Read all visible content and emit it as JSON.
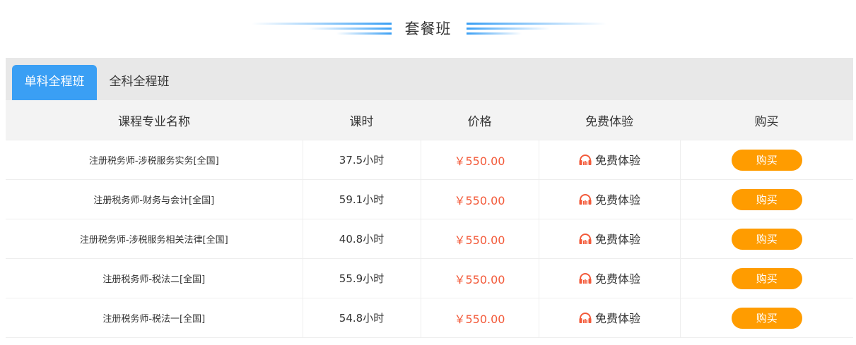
{
  "section": {
    "title": "套餐班"
  },
  "tabs": [
    {
      "label": "单科全程班",
      "active": true
    },
    {
      "label": "全科全程班",
      "active": false
    }
  ],
  "table": {
    "headers": [
      "课程专业名称",
      "课时",
      "价格",
      "免费体验",
      "购买"
    ],
    "rows": [
      {
        "name": "注册税务师-涉税服务实务[全国]",
        "hours": "37.5小时",
        "price": "￥550.00",
        "trial": "免费体验",
        "buy": "购买"
      },
      {
        "name": "注册税务师-财务与会计[全国]",
        "hours": "59.1小时",
        "price": "￥550.00",
        "trial": "免费体验",
        "buy": "购买"
      },
      {
        "name": "注册税务师-涉税服务相关法律[全国]",
        "hours": "40.8小时",
        "price": "￥550.00",
        "trial": "免费体验",
        "buy": "购买"
      },
      {
        "name": "注册税务师-税法二[全国]",
        "hours": "55.9小时",
        "price": "￥550.00",
        "trial": "免费体验",
        "buy": "购买"
      },
      {
        "name": "注册税务师-税法一[全国]",
        "hours": "54.8小时",
        "price": "￥550.00",
        "trial": "免费体验",
        "buy": "购买"
      }
    ]
  },
  "colors": {
    "tab_active": "#3a9ff4",
    "price": "#f35a3a",
    "buy_button": "#ff9c00",
    "trial_icon": "#f35a3a",
    "title_deco": "#3a9ff4"
  },
  "icons": {
    "trial": "headphones-icon"
  }
}
